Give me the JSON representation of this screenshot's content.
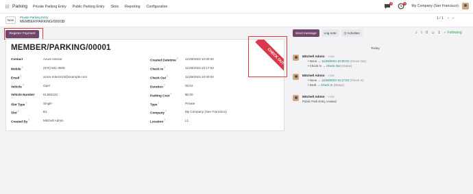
{
  "topbar": {
    "app_name": "Parking",
    "menu": [
      "Private Parking Entry",
      "Public Parking Entry",
      "Slots",
      "Reporting",
      "Configuration"
    ],
    "chat_badge": "6",
    "activity_badge": "1",
    "company": "My Company (San Francisco)"
  },
  "controlbar": {
    "new_label": "New",
    "breadcrumb": "Private Parking Entry",
    "record_name": "MEMBER/PARKING/00001",
    "pager": "1 / 1"
  },
  "actions": {
    "register_payment": "Register Payment"
  },
  "ribbon": {
    "label": "CHECK OUT",
    "color": "#d9394a"
  },
  "sheet": {
    "title": "MEMBER/PARKING/00001",
    "left_fields": [
      {
        "label": "Contact",
        "value": "Azure Interior"
      },
      {
        "label": "Mobile",
        "value": "(870)-931-0505"
      },
      {
        "label": "Email",
        "value": "azure.Interior24@example.com"
      },
      {
        "label": "Vehicle",
        "value": "Opel"
      },
      {
        "label": "Vehicle Number",
        "value": "KL582222"
      },
      {
        "label": "Slot Type",
        "value": "Single"
      },
      {
        "label": "Slot",
        "value": "B1"
      },
      {
        "label": "Created By",
        "value": "Mitchell Admin"
      }
    ],
    "right_fields": [
      {
        "label": "Created Datetime",
        "value": "11/28/2023 10:30:20"
      },
      {
        "label": "Check In",
        "value": "11/28/2023 10:17:53"
      },
      {
        "label": "Check Out",
        "value": "11/28/2023 10:30:02"
      },
      {
        "label": "Duration",
        "value": "00:02"
      },
      {
        "label": "Parking Cost",
        "value": "$0.00"
      },
      {
        "label": "Type",
        "value": "Private"
      },
      {
        "label": "Company",
        "value": "My Company (San Francisco)"
      },
      {
        "label": "Location",
        "value": "L1"
      }
    ]
  },
  "chatter": {
    "send_message": "Send message",
    "log_note": "Log note",
    "activities": "Activities",
    "attachments_count": "0",
    "followers_count": "1",
    "following": "Following",
    "today": "Today",
    "messages": [
      {
        "author": "Mitchell Admin",
        "time": "- now",
        "line1": {
          "from": "None",
          "to": "11/28/2023 10:30:02",
          "field": "(Check Out)"
        },
        "line2": {
          "from": "Check In",
          "to": "Check Out",
          "field": "(Status)"
        }
      },
      {
        "author": "Mitchell Admin",
        "time": "- now",
        "line1": {
          "from": "None",
          "to": "11/28/2023 10:17:53",
          "field": "(Check In)"
        },
        "line2": {
          "from": "Draft",
          "to": "Check In",
          "field": "(Status)"
        }
      },
      {
        "author": "Mitchell Admin",
        "time": "- now",
        "body": "Public Park Entry created"
      }
    ]
  }
}
